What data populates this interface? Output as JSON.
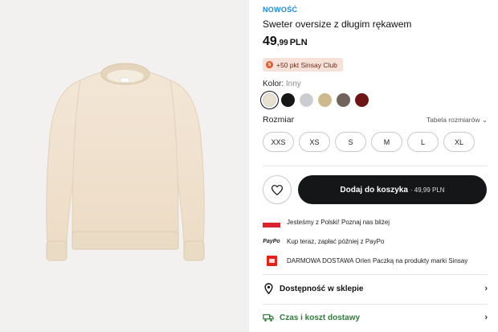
{
  "product": {
    "badge": "NOWOŚĆ",
    "title": "Sweter oversize z długim rękawem",
    "price_main": "49",
    "price_cents": ",99",
    "price_currency": "PLN",
    "club_points": "+50 pkt Sinsay Club"
  },
  "color": {
    "label": "Kolor:",
    "value": "Inny",
    "swatches": [
      "#e9e0cf",
      "#161616",
      "#c9cdd1",
      "#cdb98e",
      "#6f635c",
      "#6d1515"
    ]
  },
  "size": {
    "label": "Rozmiar",
    "table_link": "Tabela rozmiarów",
    "options": [
      "XXS",
      "XS",
      "S",
      "M",
      "L",
      "XL"
    ]
  },
  "cart": {
    "button_label": "Dodaj do koszyka",
    "button_price": "· 49,99 PLN"
  },
  "info": [
    {
      "icon": "poland-flag-icon",
      "text": "Jesteśmy z Polski! Poznaj nas bliżej"
    },
    {
      "icon": "paypo-logo-icon",
      "text": "Kup teraz, zapłać później z PayPo",
      "logo": "PayPo"
    },
    {
      "icon": "orlen-paczka-icon",
      "text": "DARMOWA DOSTAWA Orlen Paczką na produkty marki Sinsay"
    }
  ],
  "store_availability": "Dostępność w sklepie",
  "delivery": "Czas i koszt dostawy",
  "colors": {
    "accent_blue": "#1f8ad6",
    "green": "#2e7d3a",
    "button_dark": "#151618"
  }
}
